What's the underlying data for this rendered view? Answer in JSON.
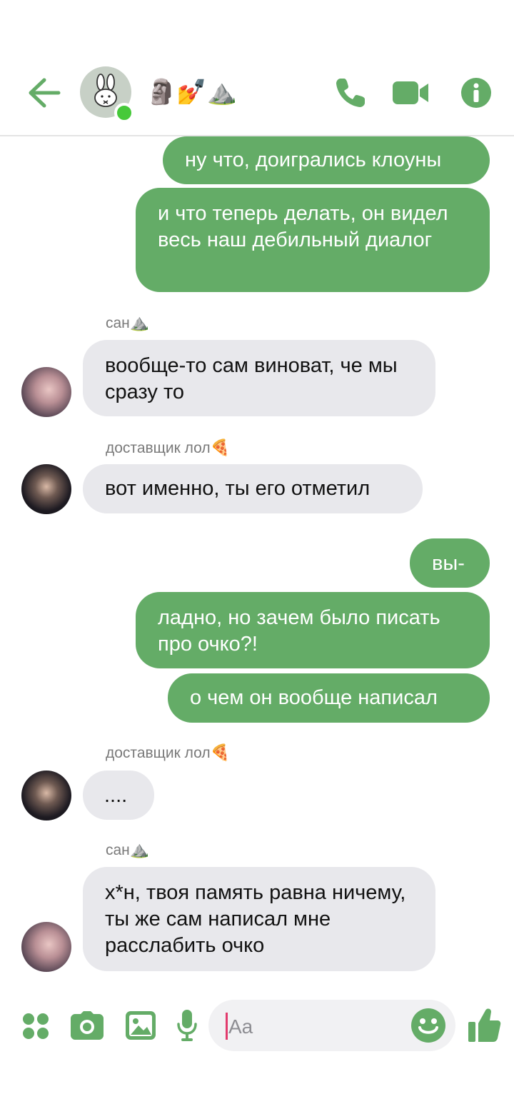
{
  "header": {
    "title": "🗿💅⛰️",
    "status": "online",
    "accent": "#64ac67"
  },
  "messages": [
    {
      "dir": "out",
      "text": "ну что, доигрались клоуны"
    },
    {
      "dir": "out",
      "text": "и что теперь делать, он видел весь наш дебильный диалог"
    },
    {
      "dir": "in",
      "sender": "сан",
      "sender_emoji": "⛰️",
      "text": "вообще-то сам виноват, че мы сразу то"
    },
    {
      "dir": "in",
      "sender": "доставщик лол",
      "sender_emoji": "🍕",
      "text": "вот именно, ты его отметил"
    },
    {
      "dir": "out",
      "text": "вы-"
    },
    {
      "dir": "out",
      "text": "ладно, но зачем было писать про очко?!"
    },
    {
      "dir": "out",
      "text": "о чем он вообще написал"
    },
    {
      "dir": "in",
      "sender": "доставщик лол",
      "sender_emoji": "🍕",
      "text": "...."
    },
    {
      "dir": "in",
      "sender": "сан",
      "sender_emoji": "⛰️",
      "text": "х*н, твоя память равна ничему, ты же сам написал мне расслабить очко"
    }
  ],
  "composer": {
    "placeholder": "Aa"
  },
  "icons": {
    "back": "back-arrow-icon",
    "call": "phone-icon",
    "video": "video-camera-icon",
    "info": "info-icon",
    "menu": "four-dots-icon",
    "camera": "camera-icon",
    "gallery": "image-icon",
    "mic": "microphone-icon",
    "emoji": "smiley-icon",
    "like": "thumbs-up-icon"
  }
}
